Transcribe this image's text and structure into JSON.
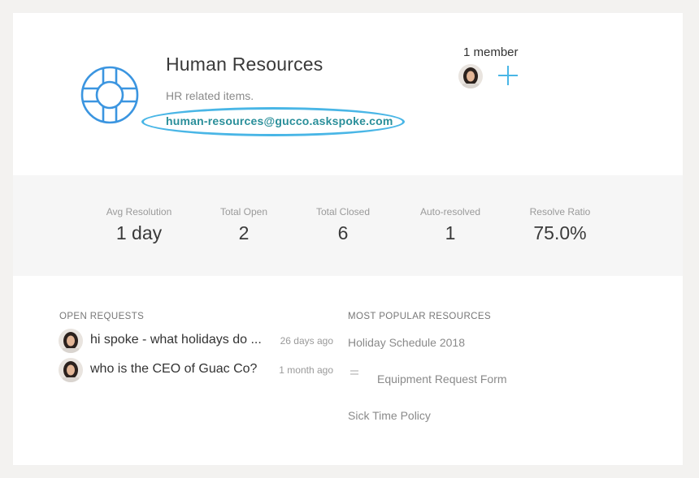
{
  "team": {
    "title": "Human Resources",
    "description": "HR related items.",
    "email": "human-resources@gucco.askspoke.com",
    "member_count": "1 member"
  },
  "stats": [
    {
      "label": "Avg Resolution",
      "value": "1 day"
    },
    {
      "label": "Total Open",
      "value": "2"
    },
    {
      "label": "Total Closed",
      "value": "6"
    },
    {
      "label": "Auto-resolved",
      "value": "1"
    },
    {
      "label": "Resolve Ratio",
      "value": "75.0%"
    }
  ],
  "open_requests": {
    "title": "OPEN REQUESTS",
    "items": [
      {
        "text": "hi spoke - what holidays do ...",
        "time": "26 days ago"
      },
      {
        "text": "who is the CEO of Guac Co?",
        "time": "1 month ago"
      }
    ]
  },
  "popular_resources": {
    "title": "MOST POPULAR RESOURCES",
    "items": [
      {
        "label": "Holiday Schedule 2018"
      },
      {
        "label": "Equipment Request Form",
        "icon": "list-icon"
      },
      {
        "label": "Sick Time Policy"
      }
    ]
  },
  "colors": {
    "accent": "#49b6e6",
    "email": "#2a8f9a",
    "icon_blue": "#3b95e0"
  }
}
